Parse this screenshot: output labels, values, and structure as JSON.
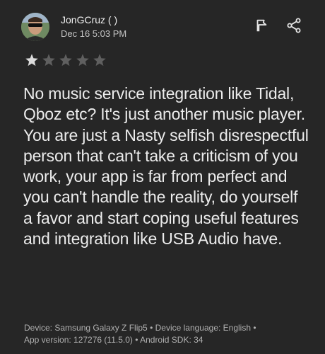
{
  "review": {
    "author": "JonGCruz ( )",
    "date": "Dec 16 5:03 PM",
    "rating": 1,
    "rating_max": 5,
    "text": "No music service integration like Tidal, Qboz etc? It's just another music player. You are just a Nasty selfish disrespectful person that can't take a criticism of you work, your app is far from perfect and you can't handle the reality, do yourself a favor and start coping useful features and integration like USB Audio have.",
    "device_line": "Device: Samsung Galaxy Z Flip5 • Device language: English •",
    "app_line": "App version: 127276 (11.5.0) • Android SDK: 34"
  },
  "icons": {
    "flag": "flag-icon",
    "share": "share-icon",
    "star_filled": "star-filled-icon",
    "star_empty": "star-empty-icon"
  },
  "colors": {
    "background": "#262626",
    "text": "#ececec",
    "star_filled": "#dcdcdc",
    "star_empty": "#5f5f5f"
  }
}
